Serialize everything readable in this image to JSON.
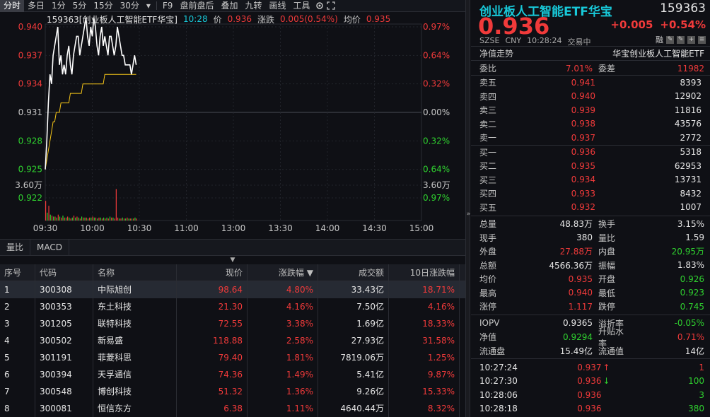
{
  "toolbar": {
    "items": [
      "分时",
      "多日",
      "1分",
      "5分",
      "15分",
      "30分",
      "F9",
      "盘前盘后",
      "叠加",
      "九转",
      "画线",
      "工具"
    ]
  },
  "chart": {
    "info": {
      "title": "159363[创业板人工智能ETF华宝]",
      "time": "10:28",
      "price_label": "价",
      "price": "0.936",
      "chg_label": "涨跌",
      "chg": "0.005(0.54%)",
      "avg_label": "均价",
      "avg": "0.935"
    },
    "left_ticks": [
      "0.940",
      "0.937",
      "0.934",
      "0.931",
      "0.928",
      "0.925",
      "0.922",
      "3.60万"
    ],
    "right_ticks": [
      "0.97%",
      "0.64%",
      "0.32%",
      "0.00%",
      "0.32%",
      "0.64%",
      "0.97%",
      "3.60万"
    ],
    "time_ticks": [
      "09:30",
      "10:00",
      "10:30",
      "11:00",
      "13:00",
      "13:30",
      "14:00",
      "14:30",
      "15:00"
    ],
    "colors": {
      "price": "#ffffff",
      "avg": "#f5c518",
      "up": "#f03a3a",
      "down": "#2fd02f"
    }
  },
  "chart_data": {
    "type": "line",
    "x": [
      "09:30",
      "09:31",
      "09:32",
      "09:33",
      "09:34",
      "09:35",
      "09:36",
      "09:37",
      "09:38",
      "09:39",
      "09:40",
      "09:41",
      "09:42",
      "09:43",
      "09:44",
      "09:45",
      "09:46",
      "09:47",
      "09:48",
      "09:49",
      "09:50",
      "09:51",
      "09:52",
      "09:53",
      "09:54",
      "09:55",
      "09:56",
      "09:57",
      "09:58",
      "09:59",
      "10:00",
      "10:01",
      "10:02",
      "10:03",
      "10:04",
      "10:05",
      "10:06",
      "10:07",
      "10:08",
      "10:09",
      "10:10",
      "10:11",
      "10:12",
      "10:13",
      "10:14",
      "10:15",
      "10:16",
      "10:17",
      "10:18",
      "10:19",
      "10:20",
      "10:21",
      "10:22",
      "10:23",
      "10:24",
      "10:25",
      "10:26",
      "10:27",
      "10:28"
    ],
    "series": [
      {
        "name": "价",
        "values": [
          0.925,
          0.928,
          0.932,
          0.935,
          0.934,
          0.937,
          0.938,
          0.939,
          0.94,
          0.936,
          0.937,
          0.935,
          0.936,
          0.935,
          0.937,
          0.938,
          0.936,
          0.935,
          0.937,
          0.938,
          0.939,
          0.939,
          0.937,
          0.938,
          0.939,
          0.94,
          0.941,
          0.939,
          0.938,
          0.94,
          0.939,
          0.941,
          0.94,
          0.938,
          0.937,
          0.939,
          0.94,
          0.938,
          0.939,
          0.938,
          0.937,
          0.939,
          0.939,
          0.938,
          0.937,
          0.938,
          0.94,
          0.939,
          0.938,
          0.937,
          0.937,
          0.936,
          0.936,
          0.936,
          0.936,
          0.935,
          0.936,
          0.937,
          0.936
        ]
      },
      {
        "name": "均价",
        "values": [
          0.925,
          0.926,
          0.927,
          0.928,
          0.929,
          0.93,
          0.93,
          0.931,
          0.931,
          0.931,
          0.932,
          0.932,
          0.932,
          0.932,
          0.932,
          0.932,
          0.933,
          0.933,
          0.933,
          0.933,
          0.933,
          0.933,
          0.933,
          0.933,
          0.934,
          0.934,
          0.934,
          0.934,
          0.934,
          0.934,
          0.934,
          0.934,
          0.934,
          0.934,
          0.934,
          0.934,
          0.934,
          0.934,
          0.935,
          0.935,
          0.935,
          0.935,
          0.935,
          0.935,
          0.935,
          0.935,
          0.935,
          0.935,
          0.935,
          0.935,
          0.935,
          0.935,
          0.935,
          0.935,
          0.935,
          0.935,
          0.935,
          0.935,
          0.935
        ]
      }
    ],
    "volume": [
      20,
      8,
      15,
      6,
      5,
      4,
      4,
      3,
      6,
      4,
      3,
      5,
      3,
      3,
      4,
      3,
      2,
      3,
      5,
      3,
      4,
      3,
      2,
      4,
      3,
      3,
      3,
      2,
      3,
      3,
      4,
      3,
      3,
      2,
      3,
      3,
      2,
      3,
      2,
      3,
      2,
      4,
      3,
      3,
      2,
      32,
      3,
      2,
      2,
      3,
      2,
      2,
      3,
      2,
      2,
      2,
      2,
      3,
      2
    ],
    "ylim": [
      0.922,
      0.94
    ],
    "yref": 0.931,
    "vol_max": 3.6
  },
  "subtabs": [
    "量比",
    "MACD"
  ],
  "table": {
    "headers": [
      "序号",
      "代码",
      "名称",
      "现价",
      "涨跌幅",
      "成交额",
      "10日涨跌幅"
    ],
    "rows": [
      [
        "1",
        "300308",
        "中际旭创",
        "98.64",
        "4.80%",
        "33.43亿",
        "18.71%"
      ],
      [
        "2",
        "300353",
        "东土科技",
        "21.30",
        "4.16%",
        "7.50亿",
        "4.16%"
      ],
      [
        "3",
        "301205",
        "联特科技",
        "72.55",
        "3.38%",
        "1.69亿",
        "18.33%"
      ],
      [
        "4",
        "300502",
        "新易盛",
        "118.88",
        "2.58%",
        "27.93亿",
        "31.58%"
      ],
      [
        "5",
        "301191",
        "菲菱科思",
        "79.40",
        "1.81%",
        "7819.06万",
        "1.25%"
      ],
      [
        "6",
        "300394",
        "天孚通信",
        "74.36",
        "1.49%",
        "5.41亿",
        "9.87%"
      ],
      [
        "7",
        "300548",
        "博创科技",
        "51.32",
        "1.36%",
        "9.26亿",
        "15.33%"
      ],
      [
        "8",
        "300081",
        "恒信东方",
        "6.38",
        "1.11%",
        "4640.44万",
        "8.32%"
      ]
    ]
  },
  "quote": {
    "name": "创业板人工智能ETF华宝",
    "code": "159363",
    "price": "0.936",
    "chg": "+0.005",
    "pct": "+0.54%",
    "market": "SZSE",
    "currency": "CNY",
    "time": "10:28:24",
    "status": "交易中",
    "tab_left": "净值走势",
    "tab_right": "华宝创业板人工智能ETF",
    "weibi_label": "委比",
    "weibi": "7.01%",
    "weicha_label": "委差",
    "weicha": "11982",
    "asks": [
      [
        "卖五",
        "0.941",
        "8393"
      ],
      [
        "卖四",
        "0.940",
        "12902"
      ],
      [
        "卖三",
        "0.939",
        "11816"
      ],
      [
        "卖二",
        "0.938",
        "43576"
      ],
      [
        "卖一",
        "0.937",
        "2772"
      ]
    ],
    "bids": [
      [
        "买一",
        "0.936",
        "5318"
      ],
      [
        "买二",
        "0.935",
        "62953"
      ],
      [
        "买三",
        "0.934",
        "13731"
      ],
      [
        "买四",
        "0.933",
        "8432"
      ],
      [
        "买五",
        "0.932",
        "1007"
      ]
    ],
    "stats": [
      [
        "总量",
        "48.83万",
        "white",
        "换手",
        "3.15%",
        "white"
      ],
      [
        "现手",
        "380",
        "white",
        "量比",
        "1.59",
        "white"
      ],
      [
        "外盘",
        "27.88万",
        "red",
        "内盘",
        "20.95万",
        "green"
      ],
      [
        "总额",
        "4566.36万",
        "white",
        "振幅",
        "1.83%",
        "white"
      ],
      [
        "均价",
        "0.935",
        "red",
        "开盘",
        "0.926",
        "green"
      ],
      [
        "最高",
        "0.940",
        "red",
        "最低",
        "0.923",
        "green"
      ],
      [
        "涨停",
        "1.117",
        "red",
        "跌停",
        "0.745",
        "green"
      ]
    ],
    "stats2": [
      [
        "IOPV",
        "0.9365",
        "white",
        "溢折率",
        "-0.05%",
        "green"
      ],
      [
        "净值",
        "0.9294",
        "green",
        "升贴水率",
        "0.71%",
        "red"
      ],
      [
        "流通盘",
        "15.49亿",
        "white",
        "流通值",
        "14亿",
        "white"
      ]
    ],
    "ticks": [
      [
        "10:27:24",
        "0.937",
        "up",
        "1"
      ],
      [
        "10:27:30",
        "0.936",
        "down",
        "100"
      ],
      [
        "10:28:06",
        "0.936",
        "",
        "3"
      ],
      [
        "10:28:18",
        "0.936",
        "",
        "380"
      ]
    ]
  }
}
